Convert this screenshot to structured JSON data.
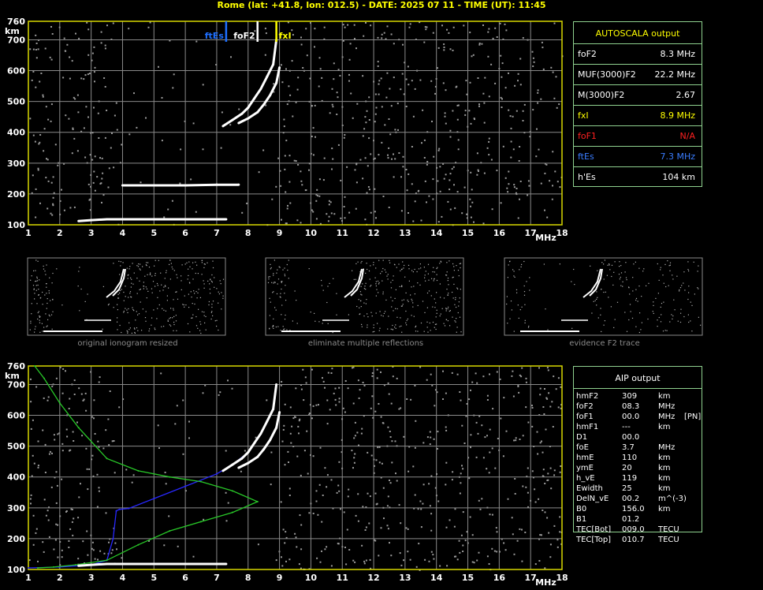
{
  "header": {
    "text": "Rome (lat: +41.8, lon: 012.5) - DATE: 2025 07 11 - TIME (UT): 11:45"
  },
  "main_plot": {
    "y_ticks": [
      "760",
      "700",
      "600",
      "500",
      "400",
      "300",
      "200",
      "100"
    ],
    "y_unit": "km",
    "x_ticks": [
      "1",
      "2",
      "3",
      "4",
      "5",
      "6",
      "7",
      "8",
      "9",
      "10",
      "11",
      "12",
      "13",
      "14",
      "15",
      "16",
      "17",
      "18"
    ],
    "x_unit": "MHz",
    "markers": [
      {
        "label": "ftEs",
        "freq": 7.3,
        "color": "#1e6fff"
      },
      {
        "label": "foF2",
        "freq": 8.3,
        "color": "#ffffff"
      },
      {
        "label": "fxI",
        "freq": 8.9,
        "color": "#ffff00"
      }
    ]
  },
  "autoscala": {
    "title": "AUTOSCALA output",
    "rows": [
      {
        "label": "foF2",
        "value": "8.3 MHz",
        "color": "#ffffff"
      },
      {
        "label": "MUF(3000)F2",
        "value": "22.2 MHz",
        "color": "#ffffff"
      },
      {
        "label": "M(3000)F2",
        "value": "2.67",
        "color": "#ffffff"
      },
      {
        "label": "fxI",
        "value": "8.9 MHz",
        "color": "#ffff00"
      },
      {
        "label": "foF1",
        "value": "N/A",
        "color": "#ff2020"
      },
      {
        "label": "ftEs",
        "value": "7.3 MHz",
        "color": "#3a7dff"
      },
      {
        "label": "h'Es",
        "value": "104   km",
        "color": "#ffffff"
      }
    ]
  },
  "thumbnails": [
    {
      "caption": "original ionogram resized"
    },
    {
      "caption": "eliminate multiple reflections"
    },
    {
      "caption": "evidence F2 trace"
    }
  ],
  "aip": {
    "title": "AIP output",
    "rows": [
      {
        "name": "hmF2",
        "value": "309",
        "unit": "km",
        "extra": ""
      },
      {
        "name": "foF2",
        "value": "08.3",
        "unit": "MHz",
        "extra": ""
      },
      {
        "name": "foF1",
        "value": "00.0",
        "unit": "MHz",
        "extra": "[PN]"
      },
      {
        "name": "hmF1",
        "value": "---",
        "unit": "km",
        "extra": ""
      },
      {
        "name": "D1",
        "value": "00.0",
        "unit": "",
        "extra": ""
      },
      {
        "name": "foE",
        "value": "3.7",
        "unit": "MHz",
        "extra": ""
      },
      {
        "name": "hmE",
        "value": "110",
        "unit": "km",
        "extra": ""
      },
      {
        "name": "ymE",
        "value": "20",
        "unit": "km",
        "extra": ""
      },
      {
        "name": "h_vE",
        "value": "119",
        "unit": "km",
        "extra": ""
      },
      {
        "name": "Ewidth",
        "value": "25",
        "unit": "km",
        "extra": ""
      },
      {
        "name": "DelN_vE",
        "value": "00.2",
        "unit": "m^(-3)",
        "extra": ""
      },
      {
        "name": "B0",
        "value": "156.0",
        "unit": "km",
        "extra": ""
      },
      {
        "name": "B1",
        "value": "01.2",
        "unit": "",
        "extra": ""
      },
      {
        "name": "TEC[Bot]",
        "value": "009.0",
        "unit": "TECU",
        "extra": ""
      },
      {
        "name": "TEC[Top]",
        "value": "010.7",
        "unit": "TECU",
        "extra": ""
      }
    ]
  },
  "chart_data": [
    {
      "type": "scatter",
      "xlim": [
        1,
        18
      ],
      "ylim": [
        100,
        760
      ],
      "xlabel": "MHz",
      "ylabel": "km",
      "grid": true,
      "series": [
        {
          "color": "#ffffff",
          "x": [
            7.2,
            7.5,
            7.8,
            8.0,
            8.2,
            8.4,
            8.6,
            8.8,
            8.9
          ],
          "y": [
            420,
            440,
            460,
            480,
            510,
            540,
            580,
            620,
            700
          ]
        },
        {
          "color": "#ffffff",
          "x": [
            7.7,
            8.0,
            8.3,
            8.5,
            8.7,
            8.9,
            9.0
          ],
          "y": [
            430,
            445,
            465,
            490,
            520,
            560,
            610
          ]
        },
        {
          "color": "#ffffff",
          "x": [
            2.6,
            3.0,
            3.5,
            4.0,
            5.0,
            6.0,
            7.0,
            7.3
          ],
          "y": [
            112,
            115,
            118,
            118,
            118,
            118,
            118,
            118
          ]
        },
        {
          "color": "#ffffff",
          "x": [
            4.0,
            5.0,
            6.0,
            7.0,
            7.7
          ],
          "y": [
            228,
            228,
            228,
            230,
            230
          ]
        }
      ]
    },
    {
      "type": "line",
      "xlim": [
        1,
        18
      ],
      "ylim": [
        100,
        760
      ],
      "xlabel": "MHz",
      "ylabel": "km",
      "grid": true,
      "series": [
        {
          "color": "#2828ff",
          "x": [
            1.0,
            2.0,
            3.0,
            3.5,
            3.7,
            3.8,
            3.9,
            4.2,
            5.0,
            6.0,
            7.0,
            7.5,
            8.0
          ],
          "y": [
            105,
            108,
            115,
            130,
            200,
            290,
            295,
            298,
            330,
            370,
            410,
            440,
            480
          ]
        },
        {
          "color": "#28c828",
          "x": [
            1.3,
            1.8,
            2.5,
            3.5,
            4.5,
            5.5,
            6.5,
            7.5,
            8.3,
            7.5,
            6.5,
            5.5,
            4.5,
            3.5,
            2.6,
            2.0,
            1.5,
            1.2
          ],
          "y": [
            105,
            108,
            115,
            130,
            180,
            225,
            255,
            285,
            320,
            355,
            385,
            400,
            420,
            460,
            560,
            640,
            720,
            760
          ]
        },
        {
          "color": "#ffffff",
          "x": [
            2.6,
            3.0,
            3.5,
            4.0,
            5.0,
            6.0,
            7.0,
            7.3
          ],
          "y": [
            112,
            115,
            118,
            118,
            118,
            118,
            118,
            118
          ]
        },
        {
          "color": "#ffffff",
          "x": [
            7.2,
            7.5,
            7.8,
            8.0,
            8.2,
            8.4,
            8.6,
            8.8,
            8.9
          ],
          "y": [
            420,
            440,
            460,
            480,
            510,
            540,
            580,
            620,
            700
          ]
        },
        {
          "color": "#ffffff",
          "x": [
            7.7,
            8.0,
            8.3,
            8.5,
            8.7,
            8.9,
            9.0
          ],
          "y": [
            430,
            445,
            465,
            490,
            520,
            560,
            610
          ]
        }
      ]
    }
  ]
}
